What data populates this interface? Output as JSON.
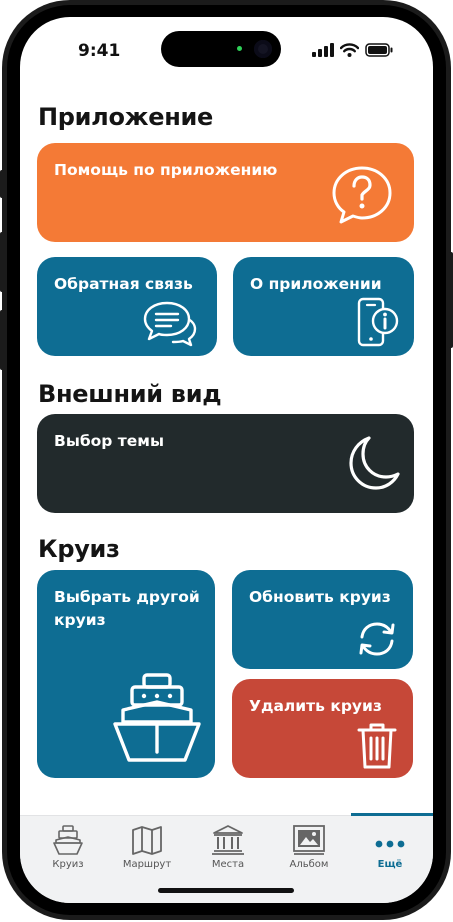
{
  "status_bar": {
    "time": "9:41"
  },
  "sections": {
    "app": {
      "title": "Приложение",
      "help": "Помощь по приложению",
      "feedback": "Обратная связь",
      "about": "О приложении"
    },
    "appearance": {
      "title": "Внешний вид",
      "theme": "Выбор темы"
    },
    "cruise": {
      "title": "Круиз",
      "choose_other": "Выбрать другой круиз",
      "update": "Обновить круиз",
      "delete": "Удалить круиз"
    }
  },
  "tabbar": {
    "items": [
      {
        "label": "Круиз",
        "icon": "ship-icon"
      },
      {
        "label": "Маршрут",
        "icon": "map-icon"
      },
      {
        "label": "Места",
        "icon": "landmark-icon"
      },
      {
        "label": "Альбом",
        "icon": "album-icon"
      },
      {
        "label": "Ещё",
        "icon": "more-dots-icon",
        "active": true
      }
    ]
  },
  "colors": {
    "orange": "#f47a36",
    "blue": "#0e6d93",
    "dark": "#222a2c",
    "red": "#c64838"
  }
}
